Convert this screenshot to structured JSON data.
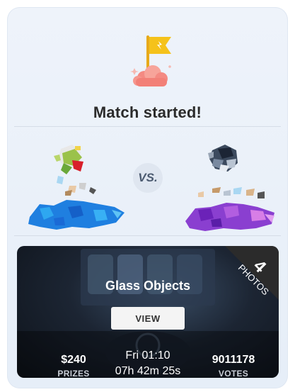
{
  "header": {
    "title": "Match started!",
    "flag_icon": "flag-on-cloud-icon"
  },
  "versus": {
    "label": "VS."
  },
  "challenge": {
    "name": "Glass Objects",
    "view_label": "VIEW",
    "photos_count": "4",
    "photos_label": "PHOTOS",
    "prize_value": "$240",
    "prize_label": "PRIZES",
    "end_day": "Fri 01:10",
    "countdown": "07h 42m 25s",
    "votes_value": "9011178",
    "votes_label": "VOTES"
  },
  "colors": {
    "team_left": "#1f7fe0",
    "team_right": "#8a3fd0",
    "ribbon": "#2b2b2b"
  }
}
